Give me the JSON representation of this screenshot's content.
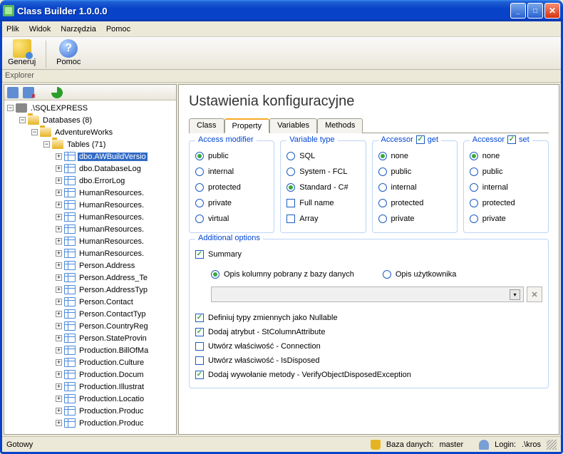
{
  "window": {
    "title": "Class Builder 1.0.0.0"
  },
  "menu": {
    "file": "Plik",
    "view": "Widok",
    "tools": "Narzędzia",
    "help": "Pomoc"
  },
  "toolbar": {
    "generate": "Generuj",
    "help": "Pomoc"
  },
  "explorer": {
    "label": "Explorer"
  },
  "tree": {
    "root": ".\\SQLEXPRESS",
    "databases_label": "Databases (8)",
    "db_name": "AdventureWorks",
    "tables_label": "Tables (71)",
    "tables": [
      "dbo.AWBuildVersio",
      "dbo.DatabaseLog",
      "dbo.ErrorLog",
      "HumanResources.",
      "HumanResources.",
      "HumanResources.",
      "HumanResources.",
      "HumanResources.",
      "HumanResources.",
      "Person.Address",
      "Person.Address_Te",
      "Person.AddressTyp",
      "Person.Contact",
      "Person.ContactTyp",
      "Person.CountryReg",
      "Person.StateProvin",
      "Production.BillOfMa",
      "Production.Culture",
      "Production.Docum",
      "Production.Illustrat",
      "Production.Locatio",
      "Production.Produc",
      "Production.Produc"
    ]
  },
  "rightpanel": {
    "title": "Ustawienia konfiguracyjne",
    "tabs": {
      "class": "Class",
      "property": "Property",
      "variables": "Variables",
      "methods": "Methods",
      "active": "property"
    },
    "groups": {
      "access_modifier": {
        "legend": "Access modifier",
        "options": [
          {
            "label": "public",
            "checked": true
          },
          {
            "label": "internal",
            "checked": false
          },
          {
            "label": "protected",
            "checked": false
          },
          {
            "label": "private",
            "checked": false
          },
          {
            "label": "virtual",
            "checked": false
          }
        ]
      },
      "variable_type": {
        "legend": "Variable type",
        "options": [
          {
            "label": "SQL",
            "checked": false
          },
          {
            "label": "System - FCL",
            "checked": false
          },
          {
            "label": "Standard - C#",
            "checked": true
          }
        ],
        "fullname": {
          "label": "Full name",
          "checked": false
        },
        "array": {
          "label": "Array",
          "checked": false
        }
      },
      "accessor_get": {
        "legend": "Accessor",
        "toggle": "get",
        "toggle_checked": true,
        "options": [
          {
            "label": "none",
            "checked": true
          },
          {
            "label": "public",
            "checked": false
          },
          {
            "label": "internal",
            "checked": false
          },
          {
            "label": "protected",
            "checked": false
          },
          {
            "label": "private",
            "checked": false
          }
        ]
      },
      "accessor_set": {
        "legend": "Accessor",
        "toggle": "set",
        "toggle_checked": true,
        "options": [
          {
            "label": "none",
            "checked": true
          },
          {
            "label": "public",
            "checked": false
          },
          {
            "label": "internal",
            "checked": false
          },
          {
            "label": "protected",
            "checked": false
          },
          {
            "label": "private",
            "checked": false
          }
        ]
      },
      "additional": {
        "legend": "Additional options",
        "summary": {
          "label": "Summary",
          "checked": true
        },
        "summary_source": [
          {
            "label": "Opis kolumny pobrany z bazy danych",
            "checked": true
          },
          {
            "label": "Opis użytkownika",
            "checked": false
          }
        ],
        "checks": [
          {
            "label": "Definiuj typy zmiennych jako Nullable",
            "checked": true
          },
          {
            "label": "Dodaj atrybut - StColumnAttribute",
            "checked": true
          },
          {
            "label": "Utwórz właściwość - Connection",
            "checked": false
          },
          {
            "label": "Utwórz właściwość - IsDisposed",
            "checked": false
          },
          {
            "label": "Dodaj wywołanie metody - VerifyObjectDisposedException",
            "checked": true
          }
        ]
      }
    }
  },
  "status": {
    "ready": "Gotowy",
    "db_label": "Baza danych:",
    "db_value": "master",
    "login_label": "Login:",
    "login_value": ".\\kros"
  }
}
